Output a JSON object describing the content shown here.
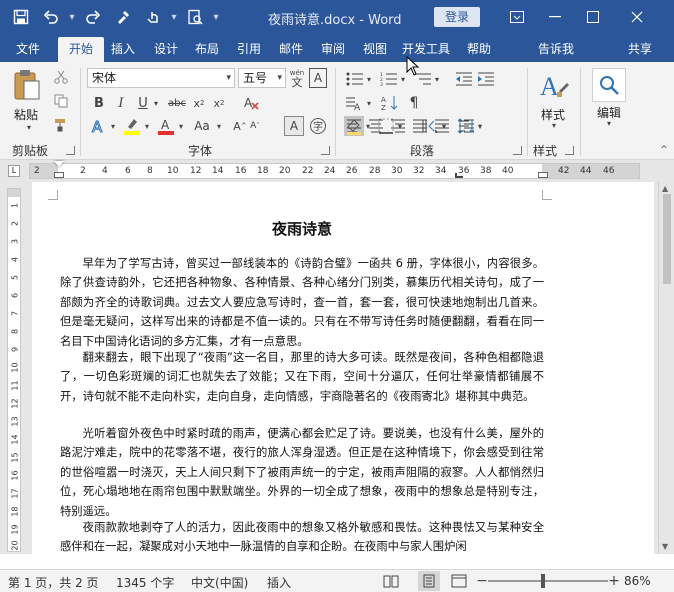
{
  "window": {
    "title": "夜雨诗意.docx  -  Word",
    "login_label": "登录",
    "min_icon": "minimize-icon",
    "restore_icon": "restore-icon",
    "close_icon": "close-icon",
    "ribbon_display_icon": "ribbon-display-options-icon"
  },
  "qat": {
    "save_icon": "save-icon",
    "undo_icon": "undo-icon",
    "redo_icon": "redo-icon",
    "format_painter_icon": "format-painter-icon",
    "touch_mode_icon": "touch-mode-icon",
    "print_preview_icon": "print-preview-icon"
  },
  "tabs": [
    {
      "label": "文件"
    },
    {
      "label": "开始"
    },
    {
      "label": "插入"
    },
    {
      "label": "设计"
    },
    {
      "label": "布局"
    },
    {
      "label": "引用"
    },
    {
      "label": "邮件"
    },
    {
      "label": "审阅"
    },
    {
      "label": "视图"
    },
    {
      "label": "开发工具"
    },
    {
      "label": "帮助"
    },
    {
      "label": "告诉我"
    },
    {
      "label": "共享"
    }
  ],
  "ribbon": {
    "clipboard": {
      "paste_label": "粘贴",
      "group_label": "剪贴板"
    },
    "font": {
      "font_name": "宋体",
      "font_size": "五号",
      "group_label": "字体",
      "phonetic_label": "wén"
    },
    "paragraph": {
      "group_label": "段落"
    },
    "styles": {
      "styles_label": "样式",
      "group_label": "样式"
    },
    "editing": {
      "editing_label": "编辑"
    }
  },
  "ruler": {
    "ticks": [
      "2",
      "2",
      "4",
      "6",
      "8",
      "10",
      "12",
      "14",
      "16",
      "18",
      "20",
      "22",
      "24",
      "26",
      "28",
      "30",
      "32",
      "34",
      "36",
      "38",
      "40",
      "42",
      "44",
      "46"
    ],
    "vticks": [
      "1",
      "2",
      "3",
      "4",
      "5",
      "6",
      "7",
      "8",
      "9",
      "10",
      "11",
      "12",
      "13",
      "14",
      "15",
      "16",
      "17",
      "18",
      "19",
      "20"
    ]
  },
  "document": {
    "title": "夜雨诗意",
    "paragraphs": [
      "早年为了学写古诗，曾买过一部线装本的《诗韵合璧》一函共 6 册，字体很小，内容很多。除了供查诗韵外，它还把各种物象、各种情景、各种心绪分门别类，慕集历代相关诗句，成了一部颇为齐全的诗歌词典。过去文人要应急写诗时，查一首，套一套，很可快速地炮制出几首来。但是毫无疑问，这样写出来的诗都是不值一读的。只有在不带写诗任务时随便翻翻，看看在同一名目下中国诗化语词的多方汇集，才有一点意思。",
      "翻来翻去，眼下出现了“夜雨”这一名目，那里的诗大多可读。既然是夜间，各种色相都隐退了，一切色彩斑斓的词汇也就失去了效能；又在下雨，空间十分逼仄，任何壮举豪情都铺展不开，诗句就不能不走向朴实，走向自身，走向情感，宇商隐著名的《夜雨寄北》堪称其中典范。",
      "光听着窗外夜色中时紧时疏的雨声，便满心都会贮足了诗。要说美，也没有什么美，屋外的路泥泞难走，院中的花零落不堪，夜行的旅人浑身湿透。但正是在这种情境下，你会感受到往常的世俗喧嚣一时浇灭，天上人间只剩下了被雨声统一的宁定，被雨声阻隔的寂寥。人人都悄然归位，死心塌地地在雨帘包围中默默端坐。外界的一切全成了想象，夜雨中的想象总是特别专注，特别遥远。",
      "夜雨款款地剥夺了人的活力，因此夜雨中的想象又格外敏感和畏怯。这种畏怯又与某种安全感伴和在一起，凝聚成对小天地中一脉温情的自享和企盼。在夜雨中与家人围炉闲"
    ]
  },
  "status": {
    "page": "第 1 页，共 2 页",
    "words": "1345 个字",
    "language": "中文(中国)",
    "mode": "插入",
    "zoom": "86%"
  }
}
